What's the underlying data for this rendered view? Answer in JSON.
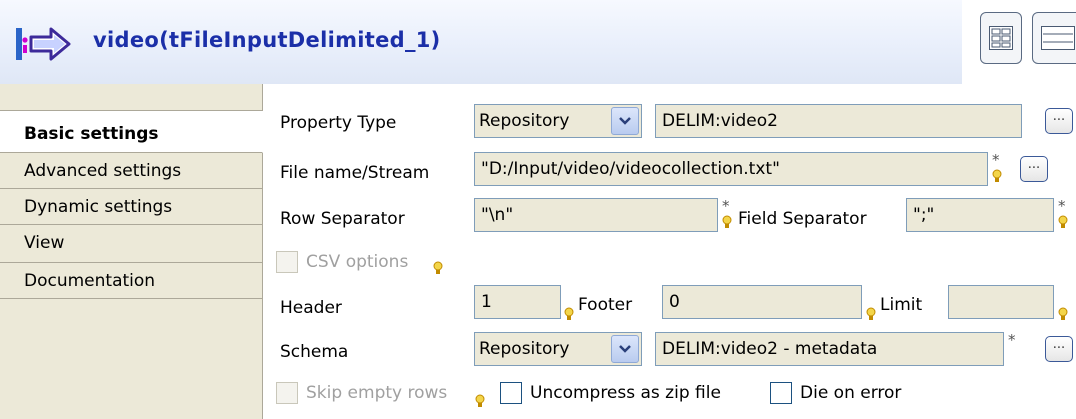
{
  "header": {
    "title": "video(tFileInputDelimited_1)"
  },
  "sidebar": {
    "tabs": [
      {
        "label": ""
      },
      {
        "label": "Basic settings"
      },
      {
        "label": "Advanced settings"
      },
      {
        "label": "Dynamic settings"
      },
      {
        "label": "View"
      },
      {
        "label": "Documentation"
      }
    ]
  },
  "form": {
    "property_type": {
      "label": "Property Type",
      "combo_value": "Repository",
      "value": "DELIM:video2",
      "button": "..."
    },
    "file_name": {
      "label": "File name/Stream",
      "value": "\"D:/Input/video/videocollection.txt\"",
      "button": "...",
      "required": "*"
    },
    "row_separator": {
      "label": "Row Separator",
      "value": "\"\\n\"",
      "required": "*"
    },
    "field_separator": {
      "label": "Field Separator",
      "value": "\";\"",
      "required": "*"
    },
    "csv_options": {
      "label": "CSV options",
      "checked": false,
      "enabled": false
    },
    "header": {
      "label": "Header",
      "value": "1"
    },
    "footer": {
      "label": "Footer",
      "value": "0"
    },
    "limit": {
      "label": "Limit",
      "value": ""
    },
    "schema": {
      "label": "Schema",
      "combo_value": "Repository",
      "value": "DELIM:video2 - metadata",
      "button": "...",
      "required": "*"
    },
    "skip_empty_rows": {
      "label": "Skip empty rows",
      "checked": false,
      "enabled": false
    },
    "uncompress_zip": {
      "label": "Uncompress as zip file",
      "checked": false
    },
    "die_on_error": {
      "label": "Die on error",
      "checked": false
    }
  },
  "icons": [
    "component-icon",
    "grid-view-icon",
    "list-view-icon",
    "dropdown-arrow-icon",
    "hint-bulb-icon"
  ],
  "colors": {
    "title": "#1b2fa8",
    "field_bg": "#ece9d8",
    "sidebar_bg": "#ece9d8",
    "field_border": "#7f9db9"
  }
}
